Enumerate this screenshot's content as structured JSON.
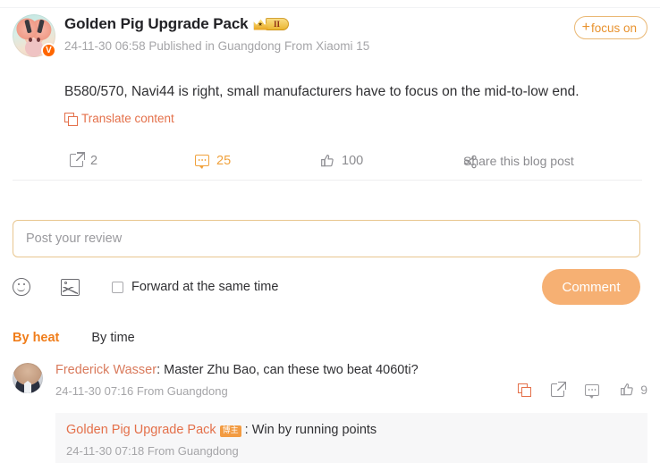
{
  "post": {
    "author": "Golden Pig Upgrade Pack",
    "level_badge": "II",
    "byline": "24-11-30 06:58 Published in Guangdong From Xiaomi 15",
    "follow_label": "focus on",
    "follow_plus": "+",
    "body": "B580/570, Navi44 is right, small manufacturers have to focus on the mid-to-low end.",
    "translate_label": "Translate content",
    "verified_mark": "V",
    "actions": {
      "share_count": "2",
      "comment_count": "25",
      "like_count": "100",
      "share_post_label": "Share this blog post"
    }
  },
  "composer": {
    "placeholder": "Post your review",
    "value": "",
    "forward_label": "Forward at the same time",
    "submit_label": "Comment"
  },
  "sort": {
    "active_label": "By heat",
    "idle_label": "By time"
  },
  "comment": {
    "user": "Frederick Wasser",
    "separator": ": ",
    "text": "Master Zhu Bao, can these two beat 4060ti?",
    "meta": "24-11-30 07:16 From Guangdong",
    "like_count": "9"
  },
  "reply": {
    "user": "Golden Pig Upgrade Pack",
    "badge": "博主",
    "separator": ": ",
    "text": "Win by running points",
    "meta": "24-11-30 07:18 From Guangdong"
  },
  "colors": {
    "accent_orange": "#f07d1a",
    "link_orange": "#e4704a",
    "button_orange": "#f6b073",
    "muted_gray": "#a5a5a8",
    "text": "#303033"
  }
}
